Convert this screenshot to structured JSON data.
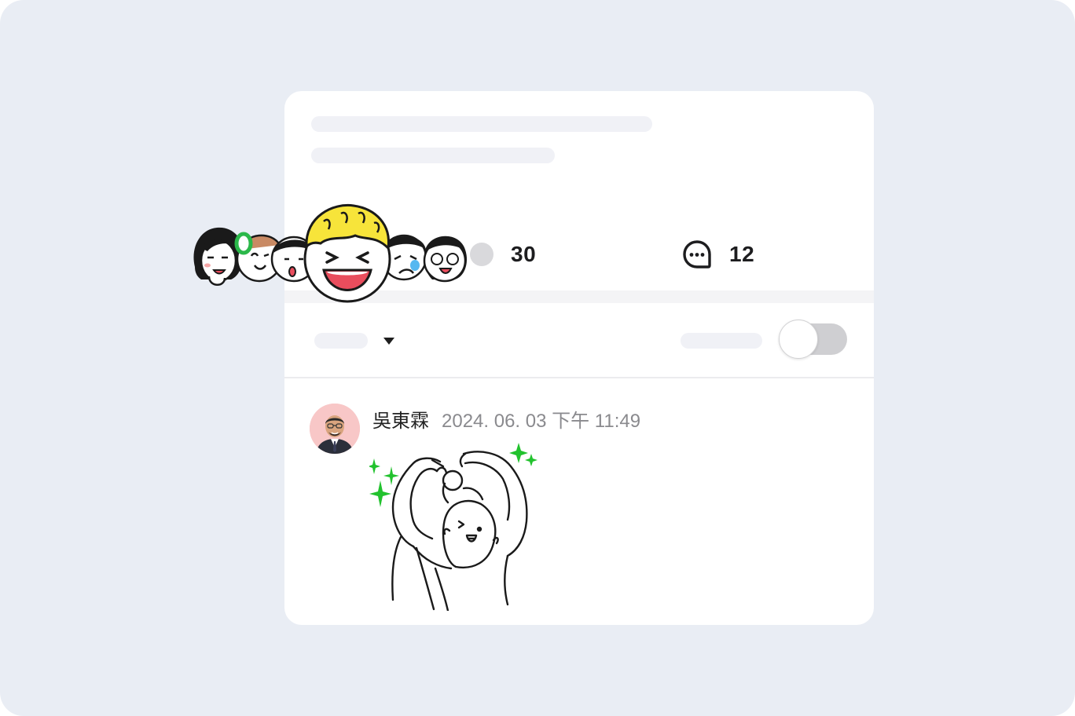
{
  "post": {
    "reaction_count": "30",
    "comment_count": "12"
  },
  "comment": {
    "username": "吳東霖",
    "timestamp": "2024. 06. 03 下午 11:49"
  },
  "colors": {
    "background": "#e9edf4",
    "card": "#ffffff",
    "skeleton": "#f0f1f6",
    "toggle_track": "#cfcfd2",
    "sparkle_green": "#22c22e",
    "yellow_hair": "#f7e43a"
  },
  "toggle": {
    "on": false
  }
}
